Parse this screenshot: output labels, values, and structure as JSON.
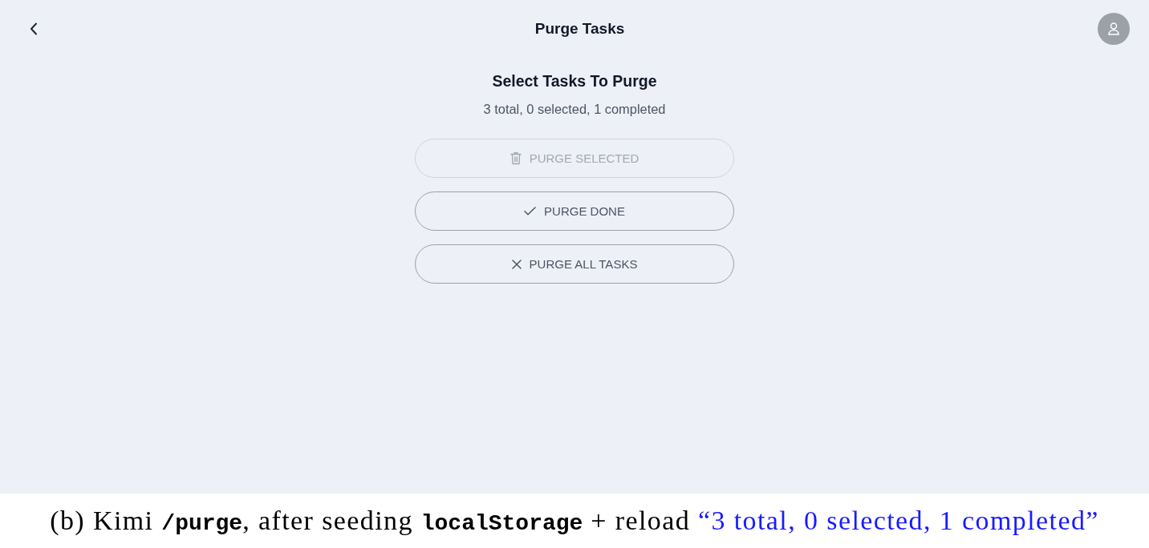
{
  "header": {
    "title": "Purge Tasks"
  },
  "content": {
    "heading": "Select Tasks To Purge",
    "summary": "3 total, 0 selected, 1 completed"
  },
  "buttons": [
    {
      "label": "PURGE SELECTED",
      "kind": "trash",
      "disabled": true
    },
    {
      "label": "PURGE DONE",
      "kind": "check",
      "disabled": false
    },
    {
      "label": "PURGE ALL TASKS",
      "kind": "cross",
      "disabled": false
    }
  ],
  "caption": {
    "segments": [
      {
        "kind": "text",
        "text": "(b) Kimi "
      },
      {
        "kind": "code",
        "text": "/purge"
      },
      {
        "kind": "text",
        "text": ", after seeding "
      },
      {
        "kind": "code",
        "text": "localStorage"
      },
      {
        "kind": "text",
        "text": " + reload "
      },
      {
        "kind": "quote",
        "text": "“3 total, 0 selected, 1 completed”"
      }
    ]
  }
}
